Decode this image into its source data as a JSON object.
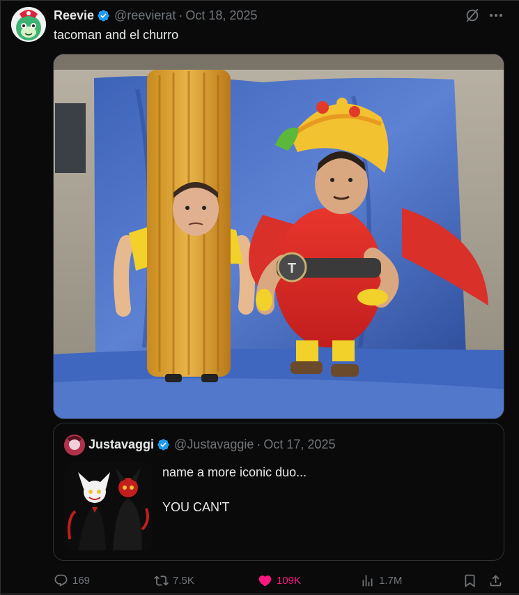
{
  "tweet": {
    "display_name": "Reevie",
    "handle": "@reevierat",
    "separator": "·",
    "date": "Oct 18, 2025",
    "text": "tacoman and el churro"
  },
  "quote": {
    "display_name": "Justavaggi",
    "handle": "@Justavaggie",
    "separator": "·",
    "date": "Oct 17, 2025",
    "text_line1": "name a more iconic duo...",
    "text_line2": "YOU CAN'T"
  },
  "actions": {
    "replies": "169",
    "reposts": "7.5K",
    "likes": "109K",
    "views": "1.7M"
  },
  "colors": {
    "background": "#000000",
    "text_primary": "#e7e9ea",
    "text_secondary": "#71767b",
    "verified": "#1d9bf0",
    "like_active": "#f91880",
    "border": "#2f3336"
  },
  "icons": {
    "verified": "verified-badge-icon",
    "grok": "grok-icon",
    "more": "more-icon",
    "reply": "reply-icon",
    "repost": "repost-icon",
    "like": "heart-icon",
    "views": "views-icon",
    "bookmark": "bookmark-icon",
    "share": "share-icon"
  }
}
